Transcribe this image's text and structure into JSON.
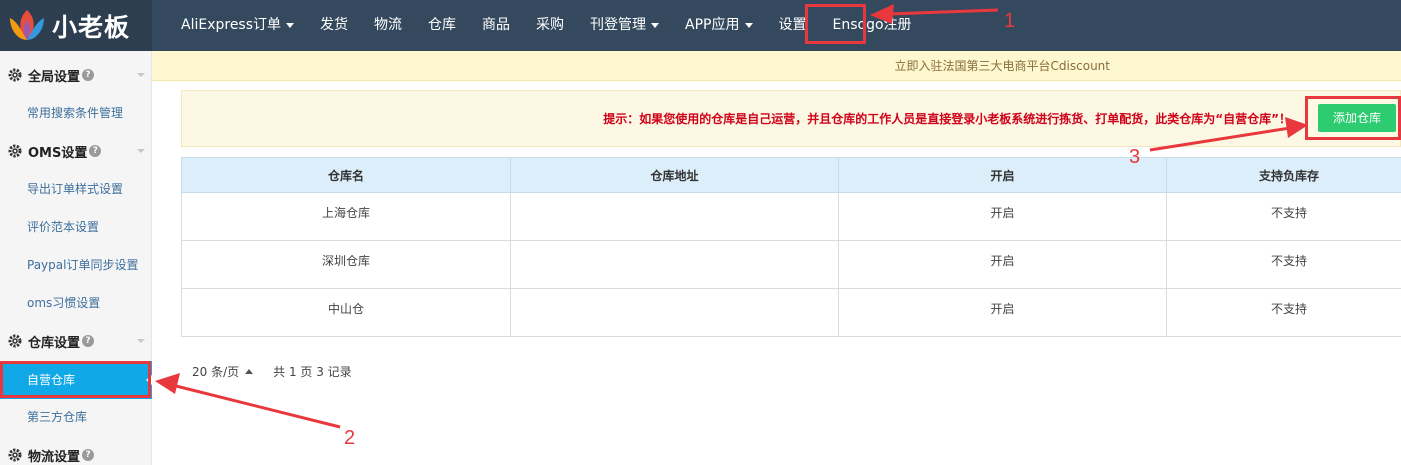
{
  "app": {
    "logo_text": "小老板"
  },
  "nav": {
    "items": [
      {
        "label": "AliExpress订单",
        "dropdown": true
      },
      {
        "label": "发货",
        "dropdown": false
      },
      {
        "label": "物流",
        "dropdown": false
      },
      {
        "label": "仓库",
        "dropdown": false
      },
      {
        "label": "商品",
        "dropdown": false
      },
      {
        "label": "采购",
        "dropdown": false
      },
      {
        "label": "刊登管理",
        "dropdown": true
      },
      {
        "label": "APP应用",
        "dropdown": true
      },
      {
        "label": "设置",
        "dropdown": false
      },
      {
        "label": "Ensogo注册",
        "dropdown": false
      }
    ]
  },
  "sidebar": {
    "global_group": "全局设置",
    "search_conditions": "常用搜索条件管理",
    "oms_group": "OMS设置",
    "export_style": "导出订单样式设置",
    "review_template": "评价范本设置",
    "paypal_sync": "Paypal订单同步设置",
    "oms_habit": "oms习惯设置",
    "warehouse_group": "仓库设置",
    "self_warehouse": "自营仓库",
    "third_warehouse": "第三方仓库",
    "logistics_group": "物流设置",
    "help_mark": "?"
  },
  "notice": {
    "text": "立即入驻法国第三大电商平台Cdiscount"
  },
  "tip": {
    "text": "提示：如果您使用的仓库是自己运营，并且仓库的工作人员是直接登录小老板系统进行拣货、打单配货，此类仓库为“自营仓库”！",
    "add_button": "添加仓库"
  },
  "table": {
    "headers": [
      "仓库名",
      "仓库地址",
      "开启",
      "支持负库存"
    ],
    "rows": [
      {
        "name": "上海仓库",
        "address": "",
        "enabled": "开启",
        "negative": "不支持"
      },
      {
        "name": "深圳仓库",
        "address": "",
        "enabled": "开启",
        "negative": "不支持"
      },
      {
        "name": "中山仓",
        "address": "",
        "enabled": "开启",
        "negative": "不支持"
      }
    ]
  },
  "pager": {
    "per_page": "20 条/页",
    "summary": "共 1 页 3 记录"
  },
  "annotations": {
    "one": "1",
    "two": "2",
    "three": "3"
  },
  "colors": {
    "nav_bg": "#34495e",
    "active_item": "#11a8e8",
    "add_button": "#2ecc71",
    "annotation": "#e8383d",
    "tip_text": "#d0021b"
  }
}
